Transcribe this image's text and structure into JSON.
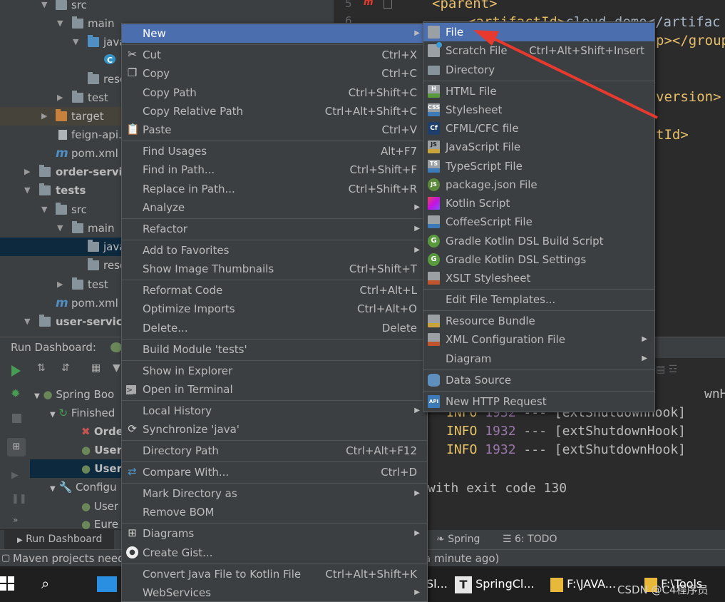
{
  "tree": {
    "rows": [
      {
        "label": "src"
      },
      {
        "label": "main"
      },
      {
        "label": "java"
      },
      {
        "label": "C"
      },
      {
        "label": "reso"
      },
      {
        "label": "test"
      },
      {
        "label": "target"
      },
      {
        "label": "feign-api.i"
      },
      {
        "label": "pom.xml"
      },
      {
        "label": "order-servic"
      },
      {
        "label": "tests"
      },
      {
        "label": "src"
      },
      {
        "label": "main"
      },
      {
        "label": "java"
      },
      {
        "label": "reso"
      },
      {
        "label": "test"
      },
      {
        "label": "pom.xml"
      },
      {
        "label": "user-service"
      }
    ]
  },
  "editor": {
    "line_numbers": [
      "5",
      "6"
    ],
    "lines": [
      {
        "tag": "<parent>",
        "text": ""
      },
      {
        "tag": "<artifactId>",
        "text": "cloud-demo</artifac"
      },
      {
        "tag": "",
        "text": "p></groupI"
      },
      {
        "tag": "",
        "text": "version>"
      },
      {
        "tag": "",
        "text": "tId>"
      }
    ]
  },
  "run": {
    "title": "Run Dashboard:",
    "tree": [
      {
        "label": "Spring Boo"
      },
      {
        "label": "Finished"
      },
      {
        "label": "Orde"
      },
      {
        "label": "User"
      },
      {
        "label": "User"
      },
      {
        "label": "Configu"
      },
      {
        "label": "User"
      },
      {
        "label": "Eure"
      }
    ],
    "log": [
      {
        "level": "INFO",
        "pid": "1932",
        "sep": "---",
        "thread": "[extShutdownHook]"
      },
      {
        "level": "INFO",
        "pid": "1932",
        "sep": "---",
        "thread": "[extShutdownHook]"
      },
      {
        "level": "INFO",
        "pid": "1932",
        "sep": "---",
        "thread": "[extShutdownHook]"
      }
    ],
    "partial_log": "wnHook]",
    "exit_line": "with exit code 130"
  },
  "bottom_tabs": {
    "run_dashboard": "Run Dashboard",
    "spring": "Spring",
    "todo": "6: TODO"
  },
  "status": {
    "text": "Maven projects need",
    "right": "a minute ago)"
  },
  "taskbar": {
    "items": [
      "Sl...",
      "SpringCl...",
      "F:\\JAVA...",
      "F:\\Tools"
    ],
    "watermark": "CSDN @C4程序员"
  },
  "menu": {
    "items": [
      {
        "label": "New",
        "shortcut": "",
        "sub": true,
        "highlighted": true
      },
      {
        "label": "Cut",
        "shortcut": "Ctrl+X",
        "icon": "scissors-icon"
      },
      {
        "label": "Copy",
        "shortcut": "Ctrl+C",
        "icon": "copy-icon"
      },
      {
        "label": "Copy Path",
        "shortcut": "Ctrl+Shift+C"
      },
      {
        "label": "Copy Relative Path",
        "shortcut": "Ctrl+Alt+Shift+C"
      },
      {
        "label": "Paste",
        "shortcut": "Ctrl+V",
        "icon": "paste-icon"
      },
      {
        "label": "Find Usages",
        "shortcut": "Alt+F7"
      },
      {
        "label": "Find in Path...",
        "shortcut": "Ctrl+Shift+F"
      },
      {
        "label": "Replace in Path...",
        "shortcut": "Ctrl+Shift+R"
      },
      {
        "label": "Analyze",
        "shortcut": "",
        "sub": true
      },
      {
        "label": "Refactor",
        "shortcut": "",
        "sub": true
      },
      {
        "label": "Add to Favorites",
        "shortcut": "",
        "sub": true
      },
      {
        "label": "Show Image Thumbnails",
        "shortcut": "Ctrl+Shift+T"
      },
      {
        "label": "Reformat Code",
        "shortcut": "Ctrl+Alt+L"
      },
      {
        "label": "Optimize Imports",
        "shortcut": "Ctrl+Alt+O"
      },
      {
        "label": "Delete...",
        "shortcut": "Delete"
      },
      {
        "label": "Build Module 'tests'",
        "shortcut": ""
      },
      {
        "label": "Show in Explorer",
        "shortcut": ""
      },
      {
        "label": "Open in Terminal",
        "shortcut": "",
        "icon": "terminal-icon"
      },
      {
        "label": "Local History",
        "shortcut": "",
        "sub": true
      },
      {
        "label": "Synchronize 'java'",
        "shortcut": "",
        "icon": "sync-icon"
      },
      {
        "label": "Directory Path",
        "shortcut": "Ctrl+Alt+F12"
      },
      {
        "label": "Compare With...",
        "shortcut": "Ctrl+D",
        "icon": "compare-icon"
      },
      {
        "label": "Mark Directory as",
        "shortcut": "",
        "sub": true
      },
      {
        "label": "Remove BOM",
        "shortcut": ""
      },
      {
        "label": "Diagrams",
        "shortcut": "",
        "sub": true,
        "icon": "diagram-icon"
      },
      {
        "label": "Create Gist...",
        "shortcut": "",
        "icon": "github-icon"
      },
      {
        "label": "Convert Java File to Kotlin File",
        "shortcut": "Ctrl+Alt+Shift+K"
      },
      {
        "label": "WebServices",
        "shortcut": "",
        "sub": true
      }
    ]
  },
  "submenu": {
    "items": [
      {
        "label": "File",
        "shortcut": "",
        "icon": "file-icon",
        "highlighted": true
      },
      {
        "label": "Scratch File",
        "shortcut": "Ctrl+Alt+Shift+Insert",
        "icon": "scratch-file-icon"
      },
      {
        "label": "Directory",
        "shortcut": "",
        "icon": "folder-icon"
      },
      {
        "label": "HTML File",
        "shortcut": "",
        "icon": "html-file-icon"
      },
      {
        "label": "Stylesheet",
        "shortcut": "",
        "icon": "css-file-icon"
      },
      {
        "label": "CFML/CFC file",
        "shortcut": "",
        "icon": "cfml-file-icon"
      },
      {
        "label": "JavaScript File",
        "shortcut": "",
        "icon": "js-file-icon"
      },
      {
        "label": "TypeScript File",
        "shortcut": "",
        "icon": "ts-file-icon"
      },
      {
        "label": "package.json File",
        "shortcut": "",
        "icon": "nodejs-icon"
      },
      {
        "label": "Kotlin Script",
        "shortcut": "",
        "icon": "kotlin-icon"
      },
      {
        "label": "CoffeeScript File",
        "shortcut": "",
        "icon": "coffeescript-icon"
      },
      {
        "label": "Gradle Kotlin DSL Build Script",
        "shortcut": "",
        "icon": "gradle-icon"
      },
      {
        "label": "Gradle Kotlin DSL Settings",
        "shortcut": "",
        "icon": "gradle-icon"
      },
      {
        "label": "XSLT Stylesheet",
        "shortcut": "",
        "icon": "xslt-icon"
      },
      {
        "label": "Edit File Templates...",
        "shortcut": ""
      },
      {
        "label": "Resource Bundle",
        "shortcut": "",
        "icon": "resource-bundle-icon"
      },
      {
        "label": "XML Configuration File",
        "shortcut": "",
        "sub": true,
        "icon": "xml-file-icon"
      },
      {
        "label": "Diagram",
        "shortcut": "",
        "sub": true
      },
      {
        "label": "Data Source",
        "shortcut": "",
        "icon": "database-icon"
      },
      {
        "label": "New HTTP Request",
        "shortcut": "",
        "icon": "api-icon"
      }
    ]
  },
  "colors": {
    "highlight": "#4b6eaf",
    "menu_bg": "#3c3f41",
    "editor_bg": "#2b2b2b",
    "arrow": "#e8392f",
    "tag": "#e8bf6a",
    "info": "#e8c46a"
  }
}
